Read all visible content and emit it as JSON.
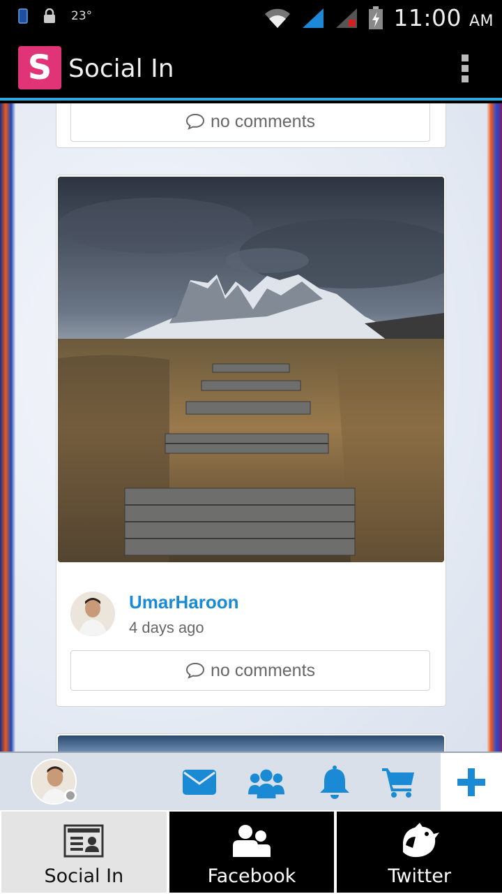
{
  "status_bar": {
    "temperature": "23°",
    "time": "11:00",
    "ampm": "AM",
    "icons": [
      "sim-icon",
      "lock-icon",
      "wifi-icon",
      "signal-icon",
      "signal-2-icon",
      "battery-charging-icon"
    ]
  },
  "action_bar": {
    "logo_letter": "S",
    "title": "Social In",
    "accent_color": "#33a8e0",
    "logo_color": "#e03477"
  },
  "feed": {
    "previous_post": {
      "comments_label": "no comments"
    },
    "post": {
      "author": "UmarHaroon",
      "time_ago": "4 days ago",
      "comments_label": "no comments"
    }
  },
  "toolbar": {
    "icons": [
      "avatar",
      "mail-icon",
      "group-icon",
      "bell-icon",
      "cart-icon",
      "plus-icon"
    ],
    "icon_color": "#1a8ad4"
  },
  "tabs": [
    {
      "label": "Social In",
      "icon": "profile-card-icon",
      "active": true
    },
    {
      "label": "Facebook",
      "icon": "people-icon",
      "active": false
    },
    {
      "label": "Twitter",
      "icon": "bird-icon",
      "active": false
    }
  ]
}
